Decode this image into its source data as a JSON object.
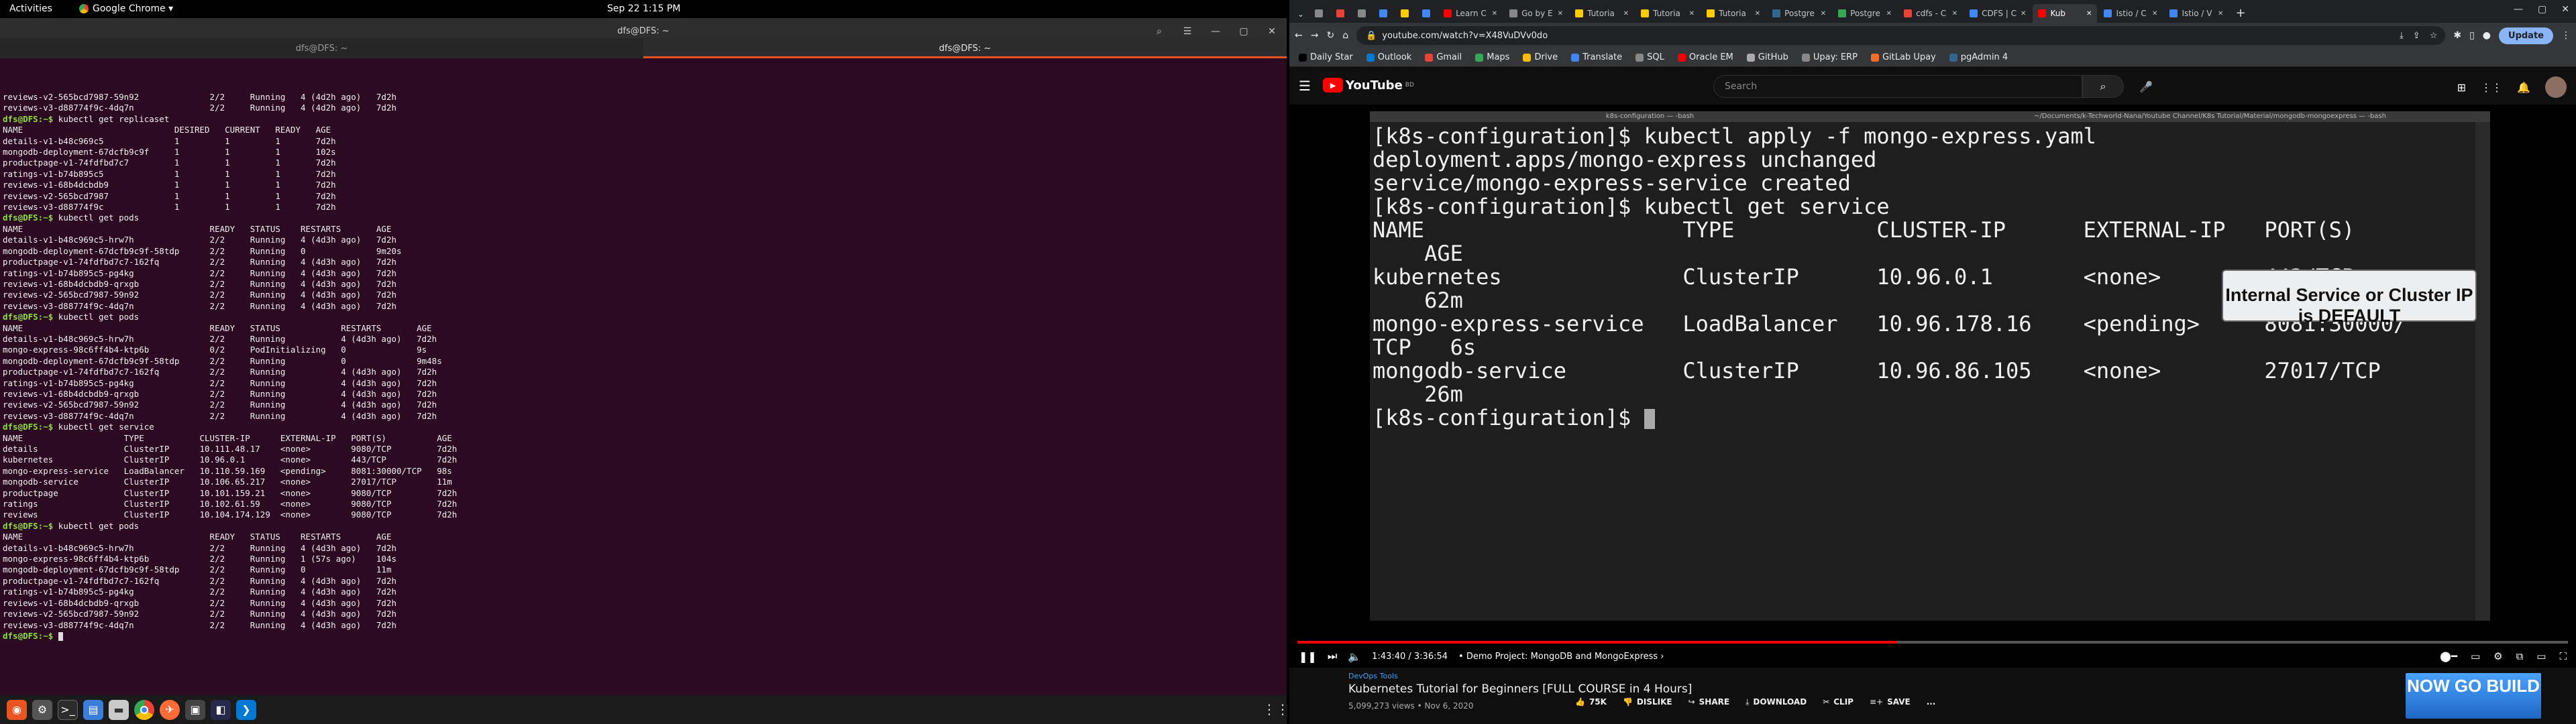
{
  "topbar": {
    "activities": "Activities",
    "app_name": "Google Chrome ▾",
    "clock": "Sep 22  1:15 PM"
  },
  "terminal": {
    "title": "dfs@DFS: ~",
    "tabs": [
      "dfs@DFS: ~",
      "dfs@DFS: ~"
    ],
    "lines": [
      {
        "p": "",
        "t": "reviews-v2-565bcd7987-59n92              2/2     Running   4 (4d2h ago)   7d2h"
      },
      {
        "p": "",
        "t": "reviews-v3-d88774f9c-4dq7n               2/2     Running   4 (4d2h ago)   7d2h"
      },
      {
        "p": "dfs@DFS:~$",
        "t": " kubectl get replicaset"
      },
      {
        "p": "",
        "t": "NAME                              DESIRED   CURRENT   READY   AGE"
      },
      {
        "p": "",
        "t": "details-v1-b48c969c5              1         1         1       7d2h"
      },
      {
        "p": "",
        "t": "mongodb-deployment-67dcfb9c9f     1         1         1       102s"
      },
      {
        "p": "",
        "t": "productpage-v1-74fdfbd7c7         1         1         1       7d2h"
      },
      {
        "p": "",
        "t": "ratings-v1-b74b895c5              1         1         1       7d2h"
      },
      {
        "p": "",
        "t": "reviews-v1-68b4dcbdb9             1         1         1       7d2h"
      },
      {
        "p": "",
        "t": "reviews-v2-565bcd7987             1         1         1       7d2h"
      },
      {
        "p": "",
        "t": "reviews-v3-d88774f9c              1         1         1       7d2h"
      },
      {
        "p": "dfs@DFS:~$",
        "t": " kubectl get pods"
      },
      {
        "p": "",
        "t": "NAME                                     READY   STATUS    RESTARTS       AGE"
      },
      {
        "p": "",
        "t": "details-v1-b48c969c5-hrw7h               2/2     Running   4 (4d3h ago)   7d2h"
      },
      {
        "p": "",
        "t": "mongodb-deployment-67dcfb9c9f-58tdp      2/2     Running   0              9m20s"
      },
      {
        "p": "",
        "t": "productpage-v1-74fdfbd7c7-162fq          2/2     Running   4 (4d3h ago)   7d2h"
      },
      {
        "p": "",
        "t": "ratings-v1-b74b895c5-pg4kg               2/2     Running   4 (4d3h ago)   7d2h"
      },
      {
        "p": "",
        "t": "reviews-v1-68b4dcbdb9-qrxgb              2/2     Running   4 (4d3h ago)   7d2h"
      },
      {
        "p": "",
        "t": "reviews-v2-565bcd7987-59n92              2/2     Running   4 (4d3h ago)   7d2h"
      },
      {
        "p": "",
        "t": "reviews-v3-d88774f9c-4dq7n               2/2     Running   4 (4d3h ago)   7d2h"
      },
      {
        "p": "dfs@DFS:~$",
        "t": " kubectl get pods"
      },
      {
        "p": "",
        "t": "NAME                                     READY   STATUS            RESTARTS       AGE"
      },
      {
        "p": "",
        "t": "details-v1-b48c969c5-hrw7h               2/2     Running           4 (4d3h ago)   7d2h"
      },
      {
        "p": "",
        "t": "mongo-express-98c6ff4b4-ktp6b            0/2     PodInitializing   0              9s"
      },
      {
        "p": "",
        "t": "mongodb-deployment-67dcfb9c9f-58tdp      2/2     Running           0              9m48s"
      },
      {
        "p": "",
        "t": "productpage-v1-74fdfbd7c7-162fq          2/2     Running           4 (4d3h ago)   7d2h"
      },
      {
        "p": "",
        "t": "ratings-v1-b74b895c5-pg4kg               2/2     Running           4 (4d3h ago)   7d2h"
      },
      {
        "p": "",
        "t": "reviews-v1-68b4dcbdb9-qrxgb              2/2     Running           4 (4d3h ago)   7d2h"
      },
      {
        "p": "",
        "t": "reviews-v2-565bcd7987-59n92              2/2     Running           4 (4d3h ago)   7d2h"
      },
      {
        "p": "",
        "t": "reviews-v3-d88774f9c-4dq7n               2/2     Running           4 (4d3h ago)   7d2h"
      },
      {
        "p": "dfs@DFS:~$",
        "t": " kubectl get service"
      },
      {
        "p": "",
        "t": "NAME                    TYPE           CLUSTER-IP      EXTERNAL-IP   PORT(S)          AGE"
      },
      {
        "p": "",
        "t": "details                 ClusterIP      10.111.48.17    <none>        9080/TCP         7d2h"
      },
      {
        "p": "",
        "t": "kubernetes              ClusterIP      10.96.0.1       <none>        443/TCP          7d2h"
      },
      {
        "p": "",
        "t": "mongo-express-service   LoadBalancer   10.110.59.169   <pending>     8081:30000/TCP   98s"
      },
      {
        "p": "",
        "t": "mongodb-service         ClusterIP      10.106.65.217   <none>        27017/TCP        11m"
      },
      {
        "p": "",
        "t": "productpage             ClusterIP      10.101.159.21   <none>        9080/TCP         7d2h"
      },
      {
        "p": "",
        "t": "ratings                 ClusterIP      10.102.61.59    <none>        9080/TCP         7d2h"
      },
      {
        "p": "",
        "t": "reviews                 ClusterIP      10.104.174.129  <none>        9080/TCP         7d2h"
      },
      {
        "p": "dfs@DFS:~$",
        "t": " kubectl get pods"
      },
      {
        "p": "",
        "t": "NAME                                     READY   STATUS    RESTARTS       AGE"
      },
      {
        "p": "",
        "t": "details-v1-b48c969c5-hrw7h               2/2     Running   4 (4d3h ago)   7d2h"
      },
      {
        "p": "",
        "t": "mongo-express-98c6ff4b4-ktp6b            2/2     Running   1 (57s ago)    104s"
      },
      {
        "p": "",
        "t": "mongodb-deployment-67dcfb9c9f-58tdp      2/2     Running   0              11m"
      },
      {
        "p": "",
        "t": "productpage-v1-74fdfbd7c7-162fq          2/2     Running   4 (4d3h ago)   7d2h"
      },
      {
        "p": "",
        "t": "ratings-v1-b74b895c5-pg4kg               2/2     Running   4 (4d3h ago)   7d2h"
      },
      {
        "p": "",
        "t": "reviews-v1-68b4dcbdb9-qrxgb              2/2     Running   4 (4d3h ago)   7d2h"
      },
      {
        "p": "",
        "t": "reviews-v2-565bcd7987-59n92              2/2     Running   4 (4d3h ago)   7d2h"
      },
      {
        "p": "",
        "t": "reviews-v3-d88774f9c-4dq7n               2/2     Running   4 (4d3h ago)   7d2h"
      },
      {
        "p": "dfs@DFS:~$",
        "t": " "
      }
    ]
  },
  "dock": {
    "icons": [
      "ubuntu-icon",
      "settings-icon",
      "terminal-icon",
      "files-icon",
      "folder-icon",
      "chrome-icon",
      "postman-icon",
      "screenshot-icon",
      "screen-recorder-icon",
      "vscode-icon"
    ]
  },
  "chrome": {
    "tabs": [
      {
        "label": "",
        "color": "#888",
        "small": true
      },
      {
        "label": "",
        "color": "#e94235",
        "small": true
      },
      {
        "label": "",
        "color": "#888",
        "small": true
      },
      {
        "label": "",
        "color": "#4285f4",
        "small": true
      },
      {
        "label": "",
        "color": "#ffcc00",
        "small": true
      },
      {
        "label": "",
        "color": "#4285f4",
        "small": true
      },
      {
        "label": "Learn C",
        "color": "#ff0000",
        "small": false
      },
      {
        "label": "Go by E",
        "color": "#888",
        "small": false
      },
      {
        "label": "Tutoria",
        "color": "#ffcc00",
        "small": false
      },
      {
        "label": "Tutoria",
        "color": "#ffcc00",
        "small": false
      },
      {
        "label": "Tutoria",
        "color": "#ffcc00",
        "small": false
      },
      {
        "label": "Postgre",
        "color": "#336791",
        "small": false
      },
      {
        "label": "Postgre",
        "color": "#34a853",
        "small": false
      },
      {
        "label": "cdfs - C",
        "color": "#e94235",
        "small": false
      },
      {
        "label": "CDFS | C",
        "color": "#4285f4",
        "small": false
      },
      {
        "label": "Kub",
        "color": "#ff0000",
        "small": false,
        "active": true
      },
      {
        "label": "Istio / C",
        "color": "#4285f4",
        "small": false
      },
      {
        "label": "Istio / V",
        "color": "#4285f4",
        "small": false
      }
    ],
    "url": "youtube.com/watch?v=X48VuDVv0do",
    "update_label": "Update",
    "bookmarks": [
      {
        "label": "Daily Star",
        "color": "#000"
      },
      {
        "label": "Outlook",
        "color": "#0078d4"
      },
      {
        "label": "Gmail",
        "color": "#ea4335"
      },
      {
        "label": "Maps",
        "color": "#34a853"
      },
      {
        "label": "Drive",
        "color": "#fbbc04"
      },
      {
        "label": "Translate",
        "color": "#4285f4"
      },
      {
        "label": "SQL",
        "color": "#888"
      },
      {
        "label": "Oracle EM",
        "color": "#f80000"
      },
      {
        "label": "GitHub",
        "color": "#aaa"
      },
      {
        "label": "Upay: ERP",
        "color": "#888"
      },
      {
        "label": "GitLab Upay",
        "color": "#fc6d26"
      },
      {
        "label": "pgAdmin 4",
        "color": "#326690"
      }
    ]
  },
  "youtube": {
    "logo_text": "YouTube",
    "logo_superscript": "BD",
    "search_placeholder": "Search",
    "video_terminal_title": "k8s-configuration — -bash",
    "video_terminal_title2": "~/Documents/k-Techworld-Nana/Youtube Channel/K8s Tutorial/Material/mongodb-mongoexpress — -bash",
    "video_terminal_lines": [
      "[k8s-configuration]$ kubectl apply -f mongo-express.yaml",
      "deployment.apps/mongo-express unchanged",
      "service/mongo-express-service created",
      "[k8s-configuration]$ kubectl get service",
      "NAME                    TYPE           CLUSTER-IP      EXTERNAL-IP   PORT(S)",
      "    AGE",
      "kubernetes              ClusterIP      10.96.0.1       <none>        443/TCP",
      "    62m",
      "mongo-express-service   LoadBalancer   10.96.178.16    <pending>     8081:30000/",
      "TCP   6s",
      "mongodb-service         ClusterIP      10.96.86.105    <none>        27017/TCP",
      "    26m"
    ],
    "video_terminal_prompt": "[k8s-configuration]$ ",
    "caption": "Internal Service or Cluster IP is DEFAULT",
    "progress_fraction": 0.472,
    "time": "1:43:40 / 3:36:54",
    "chapter": "• Demo Project: MongoDB and MongoExpress",
    "chapter_chevron": "›",
    "channel": "DevOps Tools",
    "title": "Kubernetes Tutorial for Beginners [FULL COURSE in 4 Hours]",
    "meta": "5,099,273 views • Nov 6, 2020",
    "like_count": "75K",
    "dislike": "DISLIKE",
    "share": "SHARE",
    "download": "DOWNLOAD",
    "clip": "CLIP",
    "save": "SAVE",
    "more": "...",
    "ad_text": "NOW GO BUILD"
  }
}
